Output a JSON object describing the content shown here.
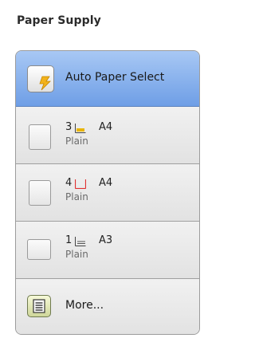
{
  "title": "Paper Supply",
  "auto_select": {
    "label": "Auto Paper Select",
    "icon": "auto-paper-select-icon",
    "selected": true
  },
  "trays": [
    {
      "number": "3",
      "size": "A4",
      "type": "Plain",
      "indicator_color": "#e8b400",
      "icon": "tray-level-icon"
    },
    {
      "number": "4",
      "size": "A4",
      "type": "Plain",
      "indicator_color": "#e03030",
      "icon": "tray-empty-icon"
    },
    {
      "number": "1",
      "size": "A3",
      "type": "Plain",
      "indicator_color": "#555555",
      "icon": "bypass-tray-icon"
    }
  ],
  "more": {
    "label": "More...",
    "icon": "list-icon"
  },
  "colors": {
    "selected_background": "#7aa8ea",
    "item_background": "#e8e8e8"
  }
}
